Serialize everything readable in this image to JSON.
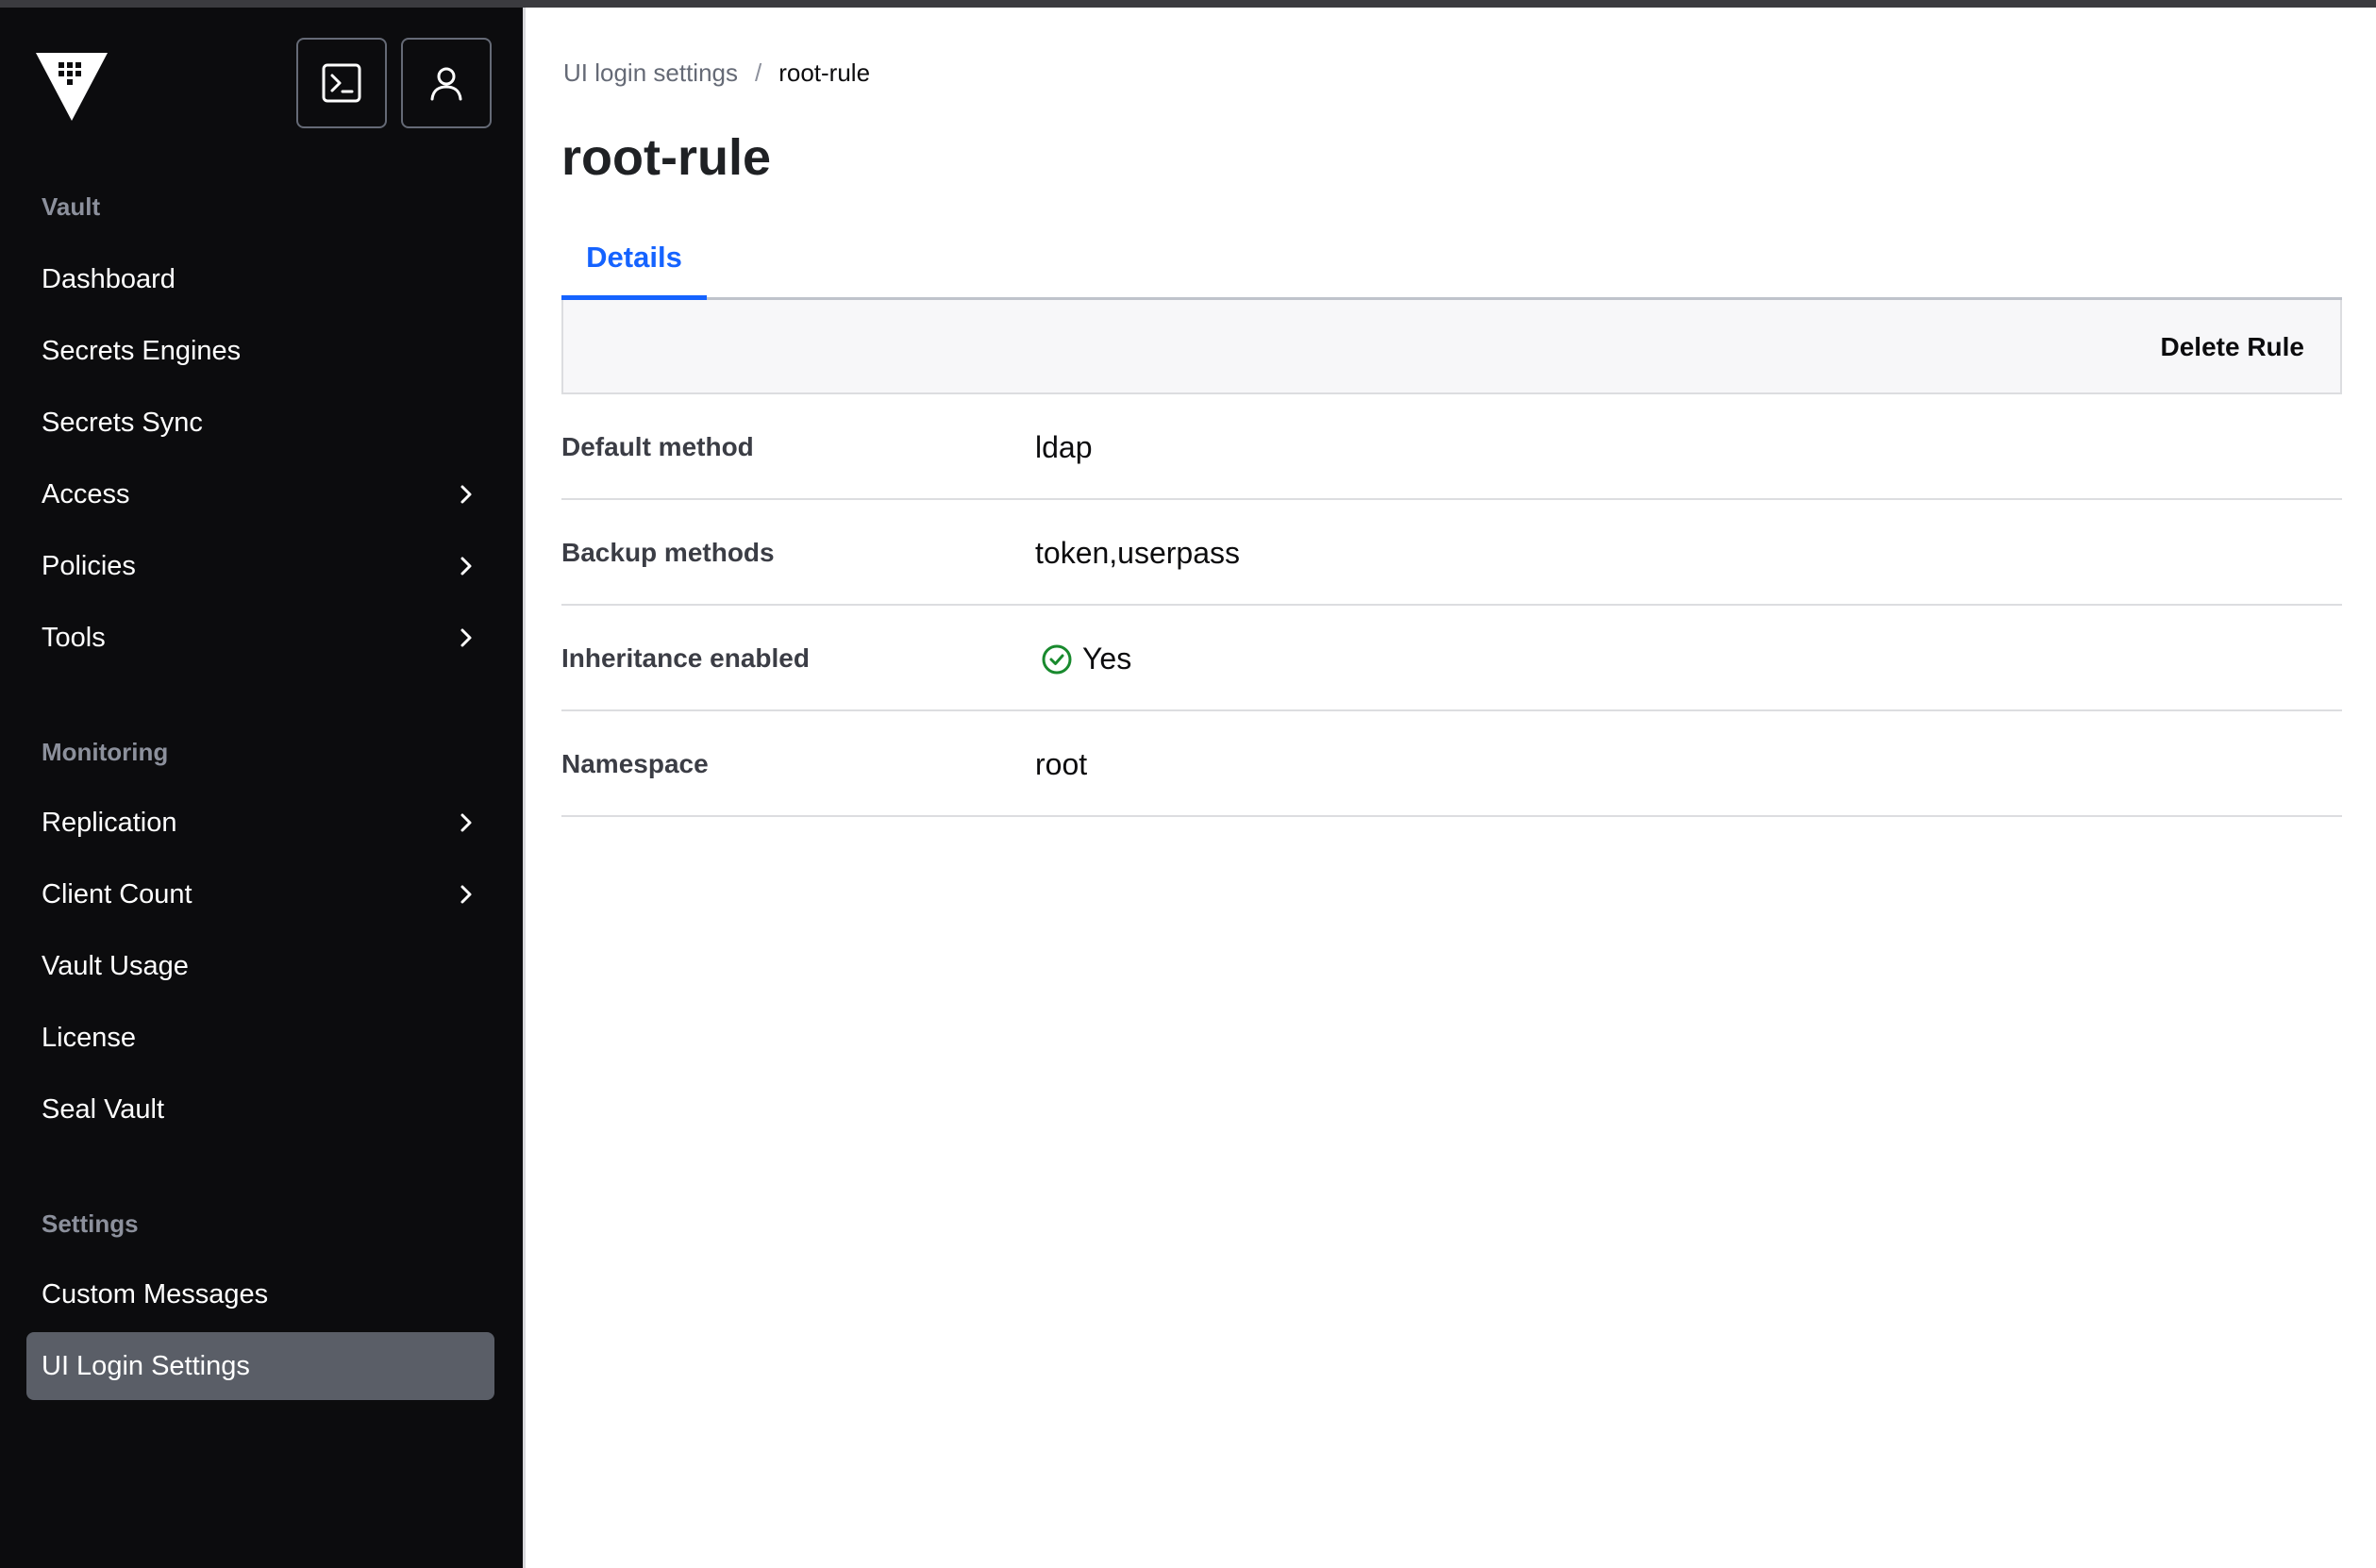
{
  "sidebar": {
    "vault_section": "Vault",
    "monitoring_section": "Monitoring",
    "settings_section": "Settings",
    "items": [
      {
        "label": "Dashboard"
      },
      {
        "label": "Secrets Engines"
      },
      {
        "label": "Secrets Sync"
      },
      {
        "label": "Access"
      },
      {
        "label": "Policies"
      },
      {
        "label": "Tools"
      },
      {
        "label": "Replication"
      },
      {
        "label": "Client Count"
      },
      {
        "label": "Vault Usage"
      },
      {
        "label": "License"
      },
      {
        "label": "Seal Vault"
      },
      {
        "label": "Custom Messages"
      },
      {
        "label": "UI Login Settings"
      }
    ],
    "active_item": "UI Login Settings",
    "icons": [
      "vault-logo-icon",
      "console-icon",
      "user-icon",
      "chevron-right-icon"
    ]
  },
  "breadcrumb": {
    "parent": "UI login settings",
    "separator": "/",
    "current": "root-rule"
  },
  "page": {
    "title": "root-rule",
    "tab": "Details",
    "delete_button": "Delete Rule"
  },
  "details": {
    "rows": [
      {
        "label": "Default method",
        "value": "ldap"
      },
      {
        "label": "Backup methods",
        "value": "token,userpass"
      },
      {
        "label": "Inheritance enabled",
        "value": "Yes"
      },
      {
        "label": "Namespace",
        "value": "root"
      }
    ]
  },
  "colors": {
    "sidebar_bg": "#0c0c0e",
    "active_item_bg": "#5a5e67",
    "tab_accent": "#1563ff",
    "check_green": "#198a2e"
  }
}
